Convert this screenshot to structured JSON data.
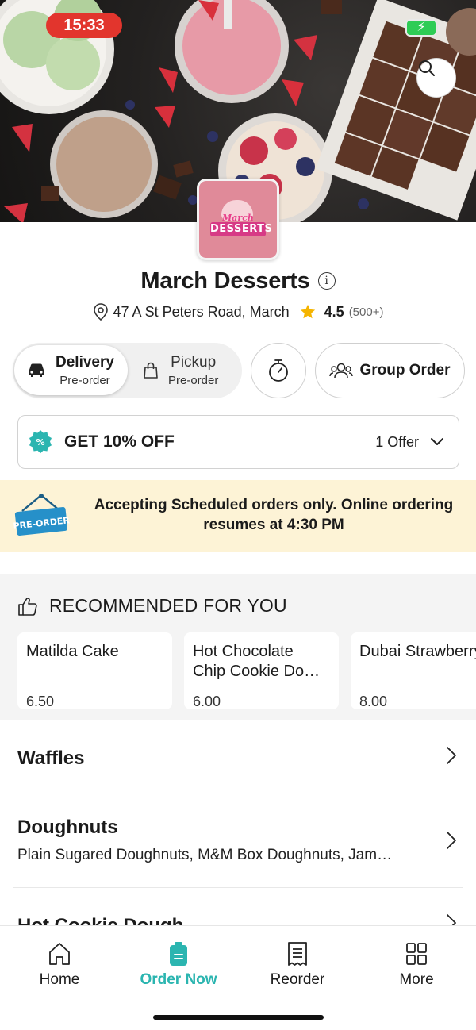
{
  "status_bar": {
    "time": "15:33",
    "battery_icon": "battery-charging-icon"
  },
  "header": {
    "search_icon": "search-icon"
  },
  "store": {
    "name": "March Desserts",
    "address": "47 A St Peters Road, March",
    "rating": "4.5",
    "rating_count": "(500+)",
    "logo_text_top": "March",
    "logo_text_bottom": "DESSERTS"
  },
  "order_type": {
    "delivery": {
      "label": "Delivery",
      "sub": "Pre-order",
      "selected": true
    },
    "pickup": {
      "label": "Pickup",
      "sub": "Pre-order",
      "selected": false
    },
    "schedule_icon": "timer-icon",
    "group_order_label": "Group Order"
  },
  "offer": {
    "title": "GET 10% OFF",
    "count": "1 Offer"
  },
  "notice": {
    "sign_text": "PRE-ORDER",
    "message": "Accepting Scheduled orders only. Online ordering resumes at 4:30 PM"
  },
  "recommended": {
    "title": "RECOMMENDED FOR YOU",
    "items": [
      {
        "name": "Matilda Cake",
        "price": "6.50"
      },
      {
        "name": "Hot Chocolate Chip Cookie Do…",
        "price": "6.00"
      },
      {
        "name": "Dubai Strawberry Cup",
        "price": "8.00"
      }
    ]
  },
  "categories": [
    {
      "title": "Waffles",
      "subtitle": ""
    },
    {
      "title": "Doughnuts",
      "subtitle": "Plain Sugared Doughnuts, M&M Box Doughnuts, Jam…"
    },
    {
      "title": "Hot Cookie Dough",
      "subtitle": ""
    }
  ],
  "tabs": [
    {
      "label": "Home",
      "icon": "home-icon",
      "active": false
    },
    {
      "label": "Order Now",
      "icon": "order-icon",
      "active": true
    },
    {
      "label": "Reorder",
      "icon": "receipt-icon",
      "active": false
    },
    {
      "label": "More",
      "icon": "grid-icon",
      "active": false
    }
  ],
  "colors": {
    "accent": "#2bb5b0",
    "notice_bg": "#fdf3d6",
    "status_red": "#e2352d",
    "star": "#f5b400"
  }
}
